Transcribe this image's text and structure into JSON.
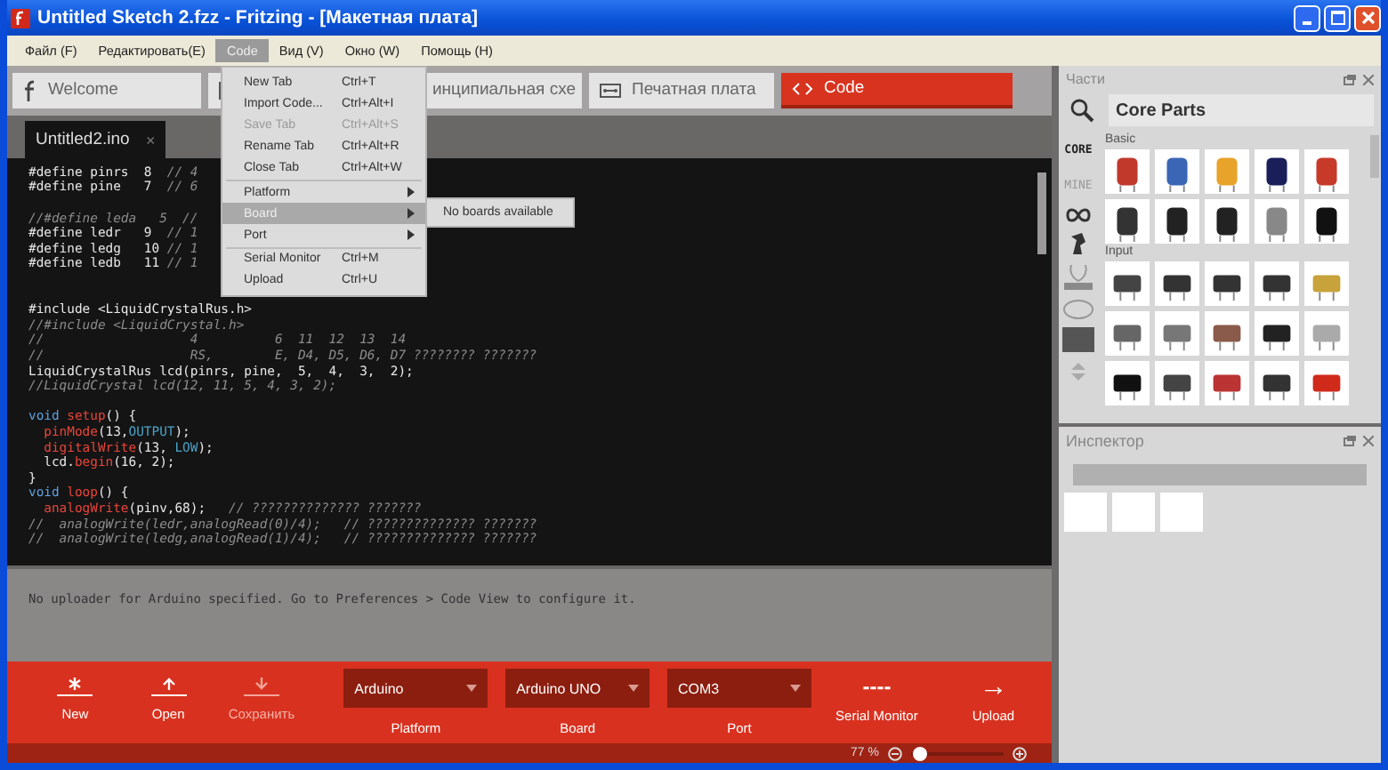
{
  "window": {
    "title": "Untitled Sketch 2.fzz - Fritzing - [Макетная плата]"
  },
  "menubar": [
    {
      "label": "Файл (F)",
      "selected": false
    },
    {
      "label": "Редактировать(E)",
      "selected": false
    },
    {
      "label": "Code",
      "selected": true
    },
    {
      "label": "Вид (V)",
      "selected": false
    },
    {
      "label": "Окно (W)",
      "selected": false
    },
    {
      "label": "Помощь (H)",
      "selected": false
    }
  ],
  "code_menu": {
    "groups": [
      [
        {
          "label": "New Tab",
          "shortcut": "Ctrl+T",
          "disabled": false,
          "selected": false,
          "submenu": false
        },
        {
          "label": "Import Code...",
          "shortcut": "Ctrl+Alt+I",
          "disabled": false,
          "selected": false,
          "submenu": false
        },
        {
          "label": "Save Tab",
          "shortcut": "Ctrl+Alt+S",
          "disabled": true,
          "selected": false,
          "submenu": false
        },
        {
          "label": "Rename Tab",
          "shortcut": "Ctrl+Alt+R",
          "disabled": false,
          "selected": false,
          "submenu": false
        },
        {
          "label": "Close Tab",
          "shortcut": "Ctrl+Alt+W",
          "disabled": false,
          "selected": false,
          "submenu": false
        }
      ],
      [
        {
          "label": "Platform",
          "disabled": false,
          "selected": false,
          "submenu": true
        },
        {
          "label": "Board",
          "disabled": false,
          "selected": true,
          "submenu": true
        },
        {
          "label": "Port",
          "disabled": false,
          "selected": false,
          "submenu": true
        }
      ],
      [
        {
          "label": "Serial Monitor",
          "shortcut": "Ctrl+M",
          "disabled": false,
          "selected": false,
          "submenu": false
        },
        {
          "label": "Upload",
          "shortcut": "Ctrl+U",
          "disabled": false,
          "selected": false,
          "submenu": false
        }
      ]
    ],
    "submenu": {
      "label": "No boards available"
    }
  },
  "view_tabs": [
    {
      "kind": "welcome",
      "label": "Welcome",
      "selected": false
    },
    {
      "kind": "breadboard",
      "selected": false
    },
    {
      "kind": "schematic",
      "label": "инципиальная схе",
      "selected": false
    },
    {
      "kind": "pcb",
      "label": "Печатная плата",
      "selected": false
    },
    {
      "kind": "code",
      "label": "Code",
      "selected": true
    }
  ],
  "file_tabs": [
    {
      "label": "Untitled2.ino",
      "close": "×",
      "selected": true
    }
  ],
  "code_lines": [
    {
      "gap_before": false,
      "segments": [
        {
          "text": "#define pinrs  8  ",
          "kind": "plain"
        },
        {
          "text": "// 4",
          "kind": "comment"
        }
      ]
    },
    {
      "gap_before": false,
      "segments": [
        {
          "text": "#define pine   7  ",
          "kind": "plain"
        },
        {
          "text": "// 6",
          "kind": "comment"
        }
      ]
    },
    {
      "gap_before": true,
      "segments": [
        {
          "text": "//#define leda   5  //",
          "kind": "comment"
        }
      ]
    },
    {
      "gap_before": false,
      "segments": [
        {
          "text": "#define ledr   9  ",
          "kind": "plain"
        },
        {
          "text": "// 1",
          "kind": "comment"
        }
      ]
    },
    {
      "gap_before": false,
      "segments": [
        {
          "text": "#define ledg   10 ",
          "kind": "plain"
        },
        {
          "text": "// 1",
          "kind": "comment"
        }
      ]
    },
    {
      "gap_before": false,
      "segments": [
        {
          "text": "#define ledb   11 ",
          "kind": "plain"
        },
        {
          "text": "// 1",
          "kind": "comment"
        }
      ]
    },
    {
      "gap_before": true,
      "segments": [
        {
          "text": "#include <LiquidCrystalRus.h>",
          "kind": "plain"
        }
      ]
    },
    {
      "gap_before": false,
      "segments": [
        {
          "text": "//#include <LiquidCrystal.h>",
          "kind": "comment"
        }
      ]
    },
    {
      "gap_before": false,
      "segments": [
        {
          "text": "//                   4          6  11  12  13  14",
          "kind": "comment"
        }
      ]
    },
    {
      "gap_before": false,
      "segments": [
        {
          "text": "//                   RS,        E, D4, D5, D6, D7 ???????? ???????",
          "kind": "comment"
        }
      ]
    },
    {
      "gap_before": false,
      "segments": [
        {
          "text": "LiquidCrystalRus lcd(pinrs, pine,  5,  4,  3,  2);",
          "kind": "plain"
        }
      ]
    },
    {
      "gap_before": false,
      "segments": [
        {
          "text": "//LiquidCrystal lcd(12, 11, 5, 4, 3, 2);",
          "kind": "comment"
        }
      ]
    },
    {
      "gap_before": true,
      "segments": [
        {
          "text": "void ",
          "kind": "keyword"
        },
        {
          "text": "setup",
          "kind": "function"
        },
        {
          "text": "() {",
          "kind": "plain"
        }
      ]
    },
    {
      "gap_before": false,
      "segments": [
        {
          "text": "  pinMode",
          "kind": "function"
        },
        {
          "text": "(13,",
          "kind": "plain"
        },
        {
          "text": "OUTPUT",
          "kind": "constant"
        },
        {
          "text": ");",
          "kind": "plain"
        }
      ]
    },
    {
      "gap_before": false,
      "segments": [
        {
          "text": "  digitalWrite",
          "kind": "function"
        },
        {
          "text": "(13, ",
          "kind": "plain"
        },
        {
          "text": "LOW",
          "kind": "constant"
        },
        {
          "text": ");",
          "kind": "plain"
        }
      ]
    },
    {
      "gap_before": false,
      "segments": [
        {
          "text": "  lcd.",
          "kind": "plain"
        },
        {
          "text": "begin",
          "kind": "function"
        },
        {
          "text": "(16, 2);",
          "kind": "plain"
        }
      ]
    },
    {
      "gap_before": false,
      "segments": [
        {
          "text": "}",
          "kind": "plain"
        }
      ]
    },
    {
      "gap_before": false,
      "segments": [
        {
          "text": "void ",
          "kind": "keyword"
        },
        {
          "text": "loop",
          "kind": "function"
        },
        {
          "text": "() {",
          "kind": "plain"
        }
      ]
    },
    {
      "gap_before": false,
      "segments": [
        {
          "text": "  analogWrite",
          "kind": "function"
        },
        {
          "text": "(pinv,68);   ",
          "kind": "plain"
        },
        {
          "text": "// ?????????????? ???????",
          "kind": "comment"
        }
      ]
    },
    {
      "gap_before": false,
      "segments": [
        {
          "text": "//  analogWrite(ledr,analogRead(0)/4);   // ?????????????? ???????",
          "kind": "comment"
        }
      ]
    },
    {
      "gap_before": false,
      "segments": [
        {
          "text": "//  analogWrite(ledg,analogRead(1)/4);   // ?????????????? ???????",
          "kind": "comment"
        }
      ]
    }
  ],
  "console": {
    "message": "No uploader for Arduino specified. Go to Preferences > Code View to configure it."
  },
  "toolbar": {
    "buttons": [
      {
        "kind": "new",
        "label": "New",
        "disabled": false
      },
      {
        "kind": "open",
        "label": "Open",
        "disabled": false
      },
      {
        "kind": "save",
        "label": "Сохранить",
        "disabled": true
      }
    ],
    "dropdowns": [
      {
        "value": "Arduino",
        "label": "Platform"
      },
      {
        "value": "Arduino UNO",
        "label": "Board"
      },
      {
        "value": "COM3",
        "label": "Port"
      }
    ],
    "actions": [
      {
        "kind": "serial",
        "symbol": "----",
        "label": "Serial Monitor"
      },
      {
        "kind": "upload",
        "symbol": "→",
        "label": "Upload"
      }
    ]
  },
  "status_bar": {
    "zoom": "77 %",
    "zoom_slider": {
      "level": 0.05
    }
  },
  "parts_panel": {
    "title": "Части",
    "search": {
      "value": "Core Parts"
    },
    "bins": [
      {
        "label": "CORE",
        "selected": true
      },
      {
        "label": "MINE",
        "selected": false
      }
    ],
    "sections": [
      "Basic",
      "Input"
    ]
  },
  "inspector": {
    "title": "Инспектор"
  }
}
